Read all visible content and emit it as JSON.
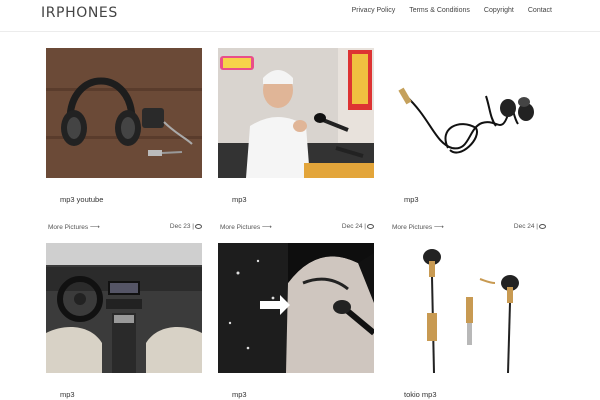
{
  "site": {
    "title": "IRPHONES"
  },
  "nav": [
    {
      "label": "Privacy Policy"
    },
    {
      "label": "Terms & Conditions"
    },
    {
      "label": "Copyright"
    },
    {
      "label": "Contact"
    }
  ],
  "posts": [
    {
      "title": "mp3 youtube",
      "more": "More Pictures",
      "date": "Dec 23 |"
    },
    {
      "title": "mp3",
      "more": "More Pictures",
      "date": "Dec 24 |"
    },
    {
      "title": "mp3",
      "more": "More Pictures",
      "date": "Dec 24 |"
    },
    {
      "title": "mp3"
    },
    {
      "title": "mp3"
    },
    {
      "title": "tokio mp3"
    }
  ],
  "icons": {
    "more_arrow": "arrow-right-icon",
    "comment": "comment-icon"
  }
}
